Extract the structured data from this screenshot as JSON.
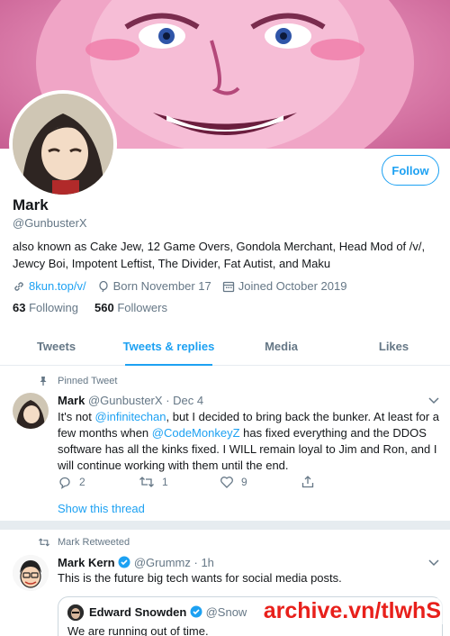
{
  "profile": {
    "name": "Mark",
    "handle": "@GunbusterX",
    "bio": "also known as Cake Jew, 12 Game Overs, Gondola Merchant, Head Mod of /v/, Jewcy Boi, Impotent Leftist, The Divider, Fat Autist, and Maku",
    "follow_label": "Follow",
    "link": "8kun.top/v/",
    "born": "Born November 17",
    "joined": "Joined October 2019",
    "following_count": "63",
    "following_label": "Following",
    "followers_count": "560",
    "followers_label": "Followers"
  },
  "tabs": [
    {
      "label": "Tweets",
      "active": false
    },
    {
      "label": "Tweets & replies",
      "active": true
    },
    {
      "label": "Media",
      "active": false
    },
    {
      "label": "Likes",
      "active": false
    }
  ],
  "pinned": {
    "context": "Pinned Tweet",
    "name": "Mark",
    "handle": "@GunbusterX",
    "date": "Dec 4",
    "text_a": "It's not ",
    "mention1": "@infinitechan",
    "text_b": ", but I decided to bring back the bunker. At least for a few months when ",
    "mention2": "@CodeMonkeyZ",
    "text_c": " has fixed everything and the DDOS software has all the kinks fixed. I WILL remain loyal to Jim and Ron, and I will continue working with them until the end.",
    "replies": "2",
    "retweets": "1",
    "likes": "9",
    "show_thread": "Show this thread"
  },
  "retweet": {
    "context": "Mark Retweeted",
    "name": "Mark Kern",
    "handle": "@Grummz",
    "date": "1h",
    "text": "This is the future big tech wants for social media posts.",
    "quote": {
      "name": "Edward Snowden",
      "handle": "@Snow",
      "text": "We are running out of time."
    }
  },
  "watermark": "archive.vn/tlwhS",
  "icons": {
    "link": "link-icon",
    "born": "balloon-icon",
    "joined": "calendar-icon",
    "pin": "pin-icon",
    "retweet": "retweet-icon",
    "reply": "reply-icon",
    "like": "heart-icon",
    "share": "share-icon",
    "chevron": "chevron-down-icon",
    "verified": "verified-icon"
  },
  "colors": {
    "accent": "#1da1f2",
    "secondary_text": "#657786",
    "watermark": "#e8201b"
  }
}
